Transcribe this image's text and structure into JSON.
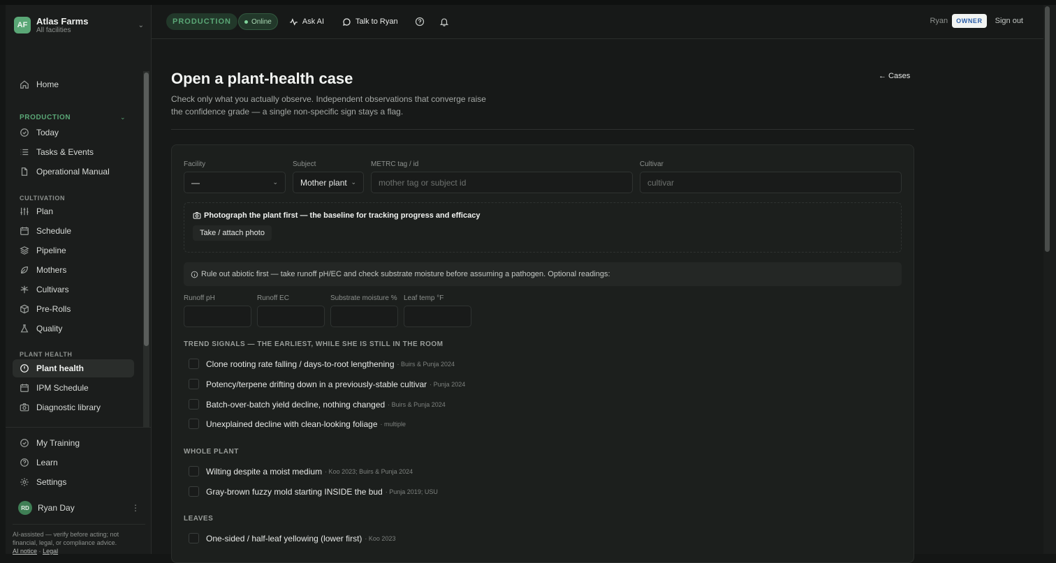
{
  "org": {
    "initials": "AF",
    "name": "Atlas Farms",
    "sub": "All facilities"
  },
  "nav": {
    "home": "Home",
    "production_header": "PRODUCTION",
    "production": [
      "Today",
      "Tasks & Events",
      "Operational Manual"
    ],
    "cultivation_header": "CULTIVATION",
    "cultivation": [
      "Plan",
      "Schedule",
      "Pipeline",
      "Mothers",
      "Cultivars",
      "Pre-Rolls",
      "Quality"
    ],
    "plant_health_header": "PLANT HEALTH",
    "plant_health": [
      "Plant health",
      "IPM Schedule",
      "Diagnostic library"
    ]
  },
  "bottom_nav": [
    "My Training",
    "Learn",
    "Settings"
  ],
  "user": {
    "initials": "RD",
    "name": "Ryan Day"
  },
  "disclaimer": {
    "text": "AI-assisted — verify before acting; not financial, legal, or compliance advice.",
    "link1": "AI notice",
    "sep": "·",
    "link2": "Legal"
  },
  "topbar": {
    "mode": "PRODUCTION",
    "status": "Online",
    "ask_ai": "Ask AI",
    "talk": "Talk to Ryan",
    "username": "Ryan",
    "role": "OWNER",
    "signout": "Sign out"
  },
  "page": {
    "title": "Open a plant-health case",
    "desc": "Check only what you actually observe. Independent observations that converge raise the confidence grade — a single non-specific sign stays a flag.",
    "back": "← Cases"
  },
  "form": {
    "facility_label": "Facility",
    "facility_value": "—",
    "subject_label": "Subject",
    "subject_value": "Mother plant",
    "tag_label": "METRC tag / id",
    "tag_placeholder": "mother tag or subject id",
    "cultivar_label": "Cultivar",
    "cultivar_placeholder": "cultivar",
    "photo_title": "Photograph the plant first — the baseline for tracking progress and efficacy",
    "photo_button": "Take / attach photo",
    "abiotic": "Rule out abiotic first — take runoff pH/EC and check substrate moisture before assuming a pathogen. Optional readings:",
    "readings": [
      "Runoff pH",
      "Runoff EC",
      "Substrate moisture %",
      "Leaf temp °F"
    ]
  },
  "groups": {
    "trend": {
      "title": "TREND SIGNALS — THE EARLIEST, WHILE SHE IS STILL IN THE ROOM",
      "items": [
        {
          "label": "Clone rooting rate falling / days-to-root lengthening",
          "cite": "· Buirs & Punja 2024"
        },
        {
          "label": "Potency/terpene drifting down in a previously-stable cultivar",
          "cite": "· Punja 2024"
        },
        {
          "label": "Batch-over-batch yield decline, nothing changed",
          "cite": "· Buirs & Punja 2024"
        },
        {
          "label": "Unexplained decline with clean-looking foliage",
          "cite": "· multiple"
        }
      ]
    },
    "whole": {
      "title": "WHOLE PLANT",
      "items": [
        {
          "label": "Wilting despite a moist medium",
          "cite": "· Koo 2023; Buirs & Punja 2024"
        },
        {
          "label": "Gray-brown fuzzy mold starting INSIDE the bud",
          "cite": "· Punja 2019; USU"
        }
      ]
    },
    "leaves": {
      "title": "LEAVES",
      "items": [
        {
          "label": "One-sided / half-leaf yellowing (lower first)",
          "cite": "· Koo 2023"
        }
      ]
    }
  }
}
